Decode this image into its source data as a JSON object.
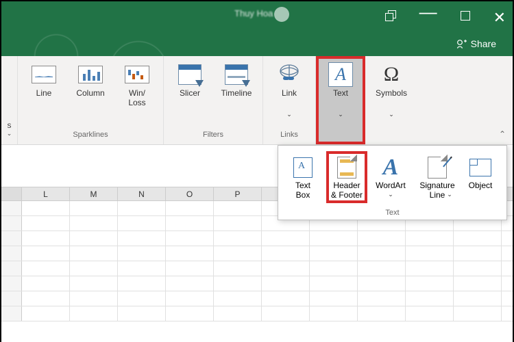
{
  "titlebar": {
    "doc_title": "Thuy Hoa",
    "share_label": "Share"
  },
  "ribbon": {
    "groups": {
      "sparklines": {
        "label": "Sparklines",
        "line": "Line",
        "column": "Column",
        "winloss": "Win/\nLoss"
      },
      "filters": {
        "label": "Filters",
        "slicer": "Slicer",
        "timeline": "Timeline"
      },
      "links": {
        "label": "Links",
        "link": "Link"
      },
      "text_group": {
        "text": "Text"
      },
      "symbols_group": {
        "symbols": "Symbols"
      }
    }
  },
  "dropdown": {
    "label": "Text",
    "textbox": "Text\nBox",
    "header_footer": "Header\n& Footer",
    "wordart": "WordArt",
    "signature": "Signature\nLine",
    "object": "Object"
  },
  "columns": [
    "L",
    "M",
    "N",
    "O",
    "P"
  ]
}
